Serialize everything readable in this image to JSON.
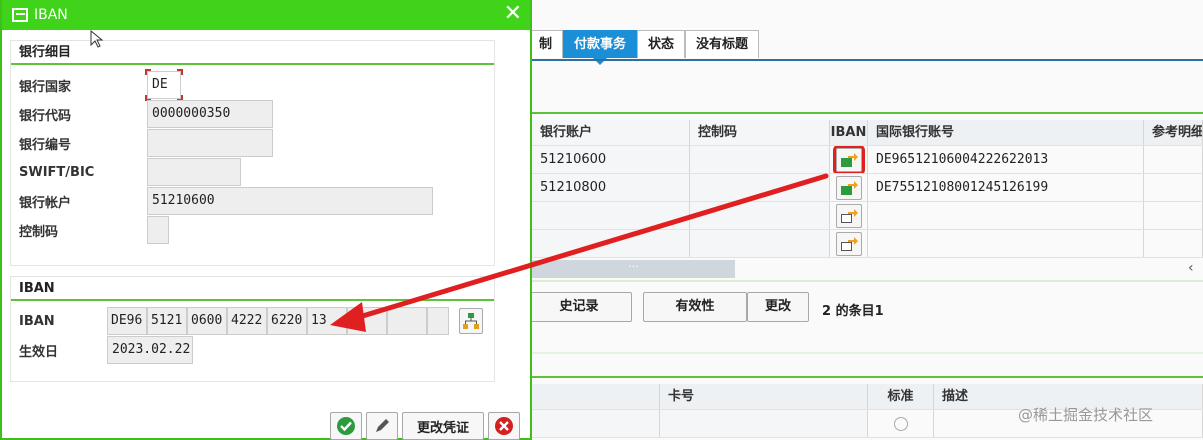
{
  "tabs": [
    "制",
    "付款事务",
    "状态",
    "没有标题"
  ],
  "table1": {
    "headers": [
      "银行账户",
      "控制码",
      "IBAN",
      "国际银行账号",
      "参考明细"
    ],
    "rows": [
      {
        "account": "51210600",
        "control": "",
        "iban": "DE96512106004222622013"
      },
      {
        "account": "51210800",
        "control": "",
        "iban": "DE75512108001245126199"
      },
      {
        "account": "",
        "control": "",
        "iban": ""
      },
      {
        "account": "",
        "control": "",
        "iban": ""
      }
    ],
    "scroll_label": "···"
  },
  "buttons": {
    "history": "史记录",
    "validity": "有效性",
    "change": "更改",
    "count": "2 的条目1"
  },
  "table2": {
    "headers": [
      "",
      "卡号",
      "标准",
      "描述"
    ]
  },
  "watermark": "@稀土掘金技术社区",
  "dialog": {
    "title": "IBAN",
    "close": "✕",
    "bank_group": {
      "header": "银行细目",
      "fields": [
        {
          "label": "银行国家",
          "value": "DE"
        },
        {
          "label": "银行代码",
          "value": "0000000350"
        },
        {
          "label": "银行编号",
          "value": ""
        },
        {
          "label": "SWIFT/BIC",
          "value": ""
        },
        {
          "label": "银行帐户",
          "value": "51210600"
        },
        {
          "label": "控制码",
          "value": ""
        }
      ]
    },
    "iban_group": {
      "header": "IBAN",
      "iban_label": "IBAN",
      "iban_parts": [
        "DE96",
        "5121",
        "0600",
        "4222",
        "6220",
        "13",
        "",
        "",
        ""
      ],
      "valid_label": "生效日",
      "valid_value": "2023.02.22"
    },
    "footer": {
      "change_doc": "更改凭证"
    }
  },
  "colors": {
    "title_green": "#3fd31a",
    "tab_blue": "#1a8fd8",
    "arrow_red": "#e02020"
  }
}
